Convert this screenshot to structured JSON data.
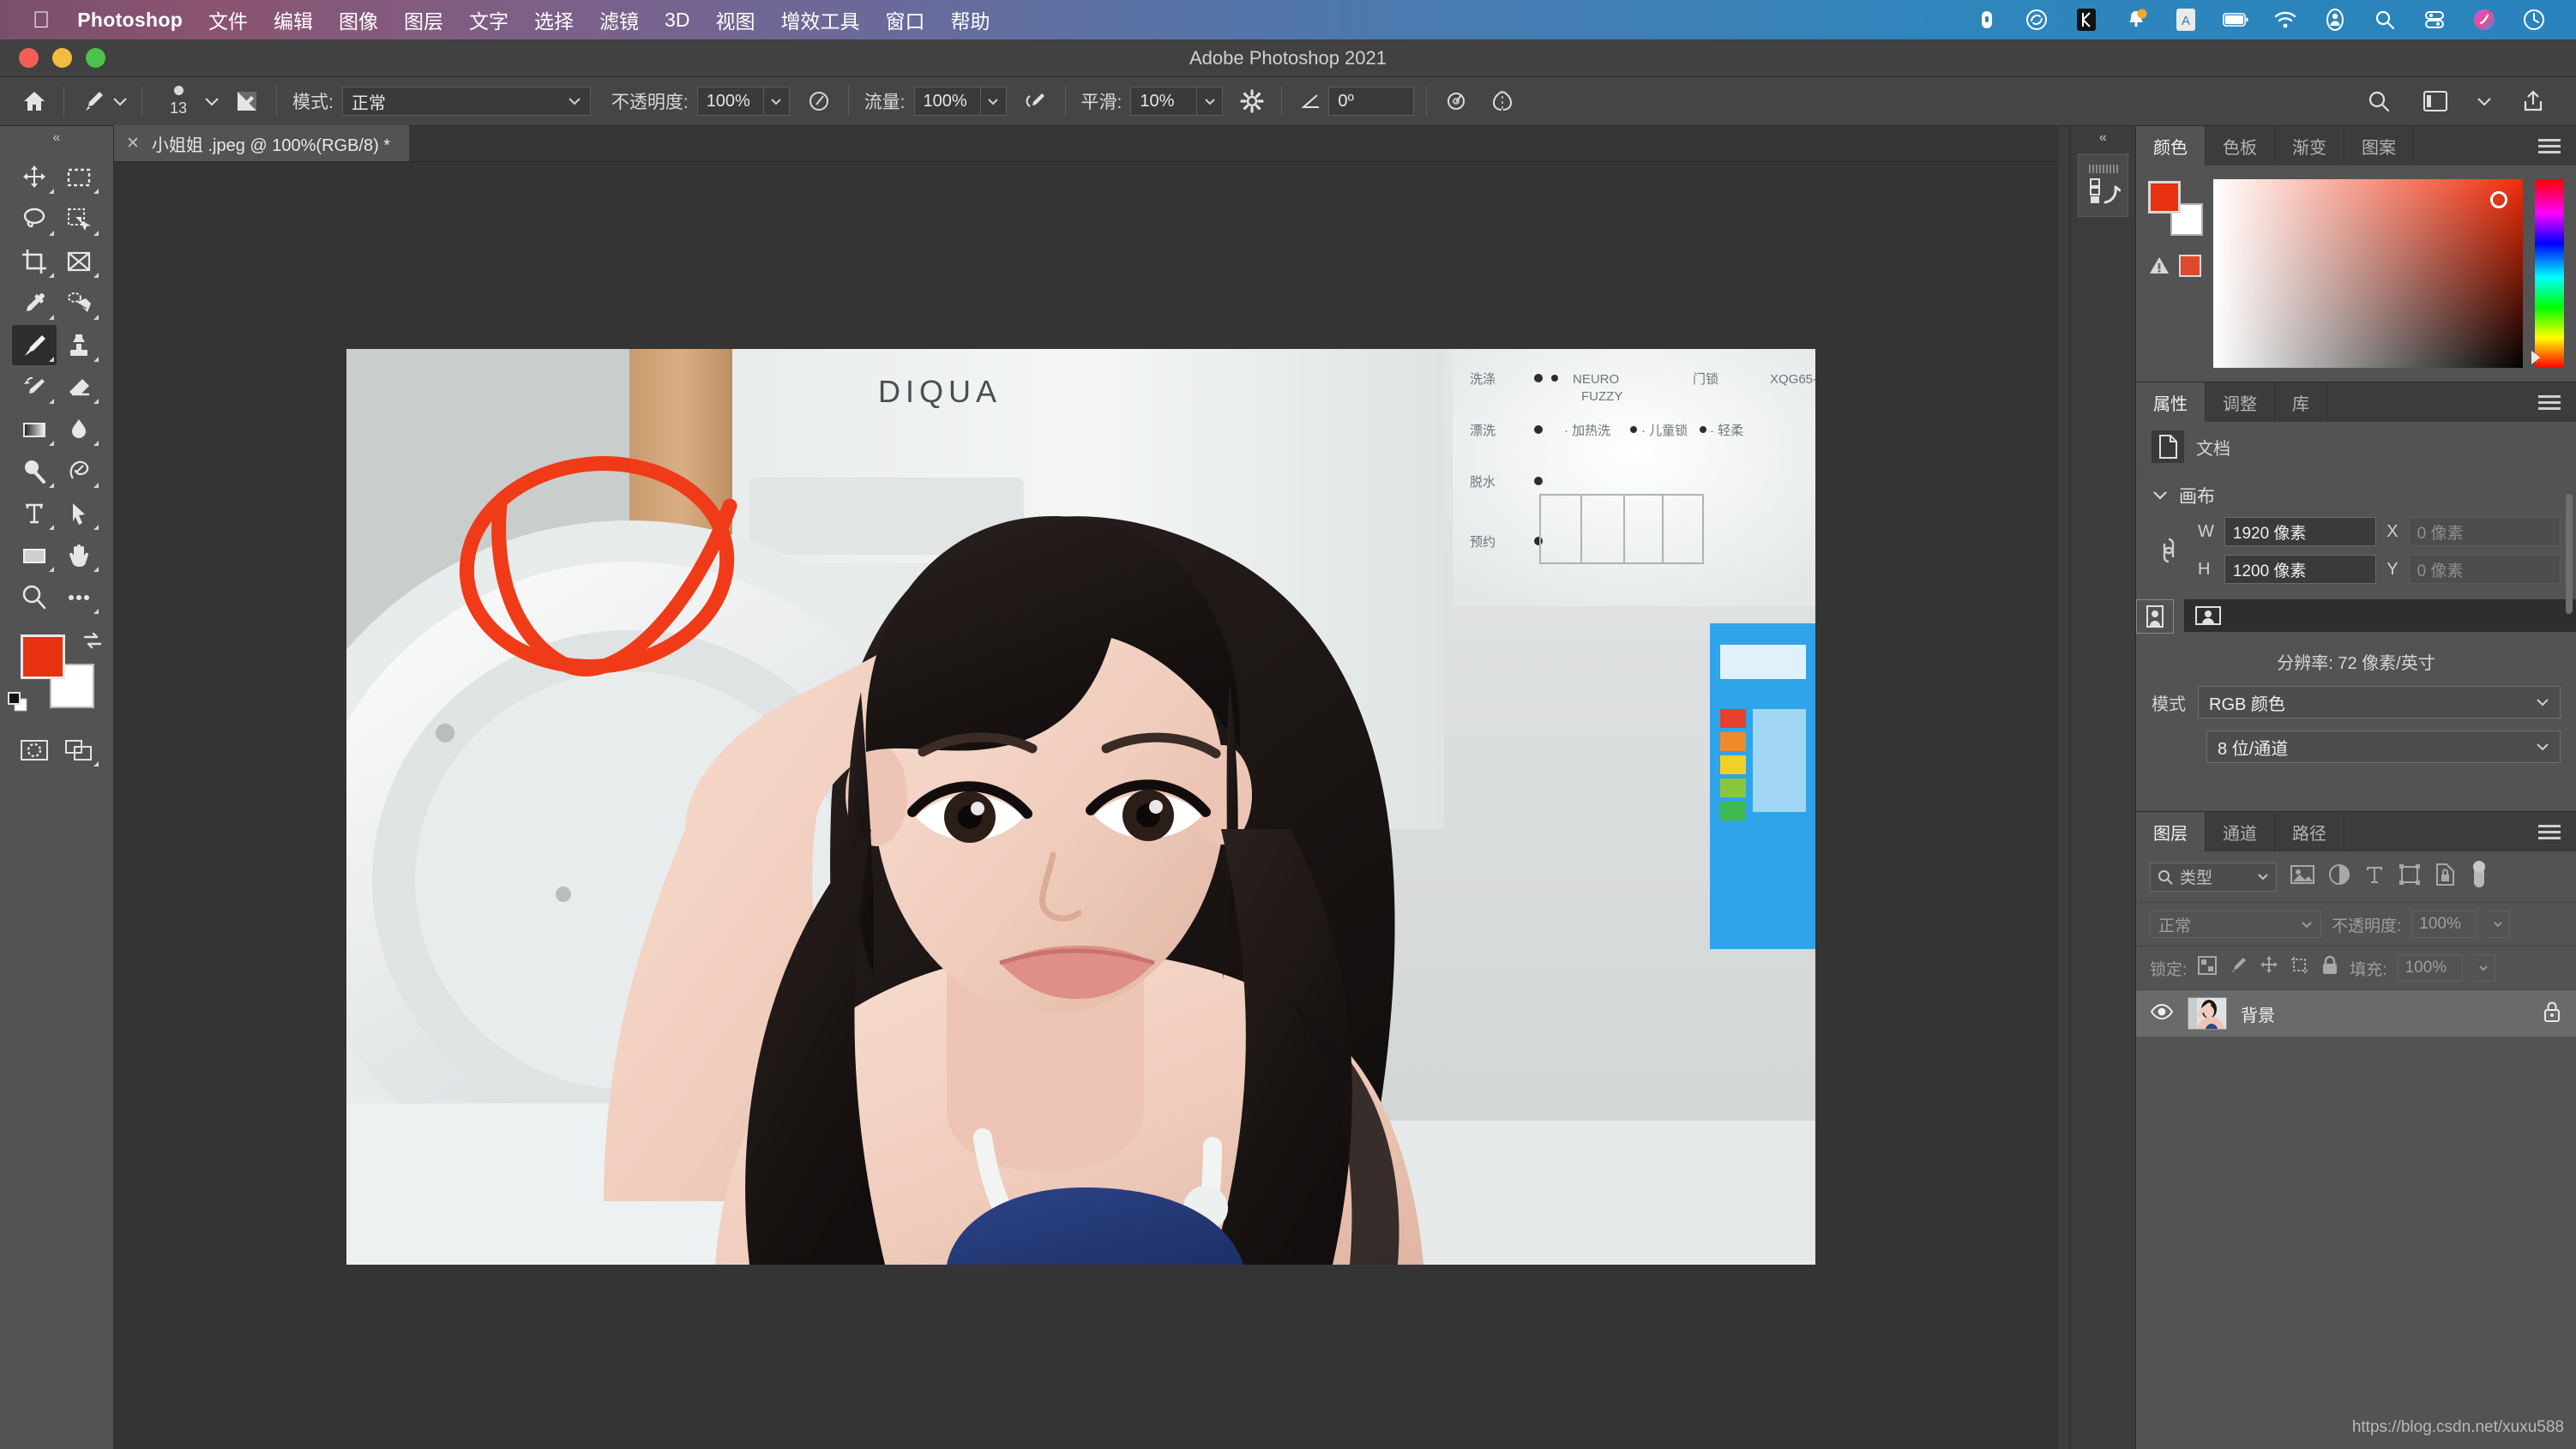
{
  "macmenu": {
    "app_name": "Photoshop",
    "items": [
      "文件",
      "编辑",
      "图像",
      "图层",
      "文字",
      "选择",
      "滤镜",
      "3D",
      "视图",
      "增效工具",
      "窗口",
      "帮助"
    ],
    "status_icons": [
      "record-icon",
      "creative-cloud-icon",
      "app-k-icon",
      "bell-icon",
      "input-source-icon",
      "battery-icon",
      "wifi-icon",
      "user-icon",
      "spotlight-search-icon",
      "control-center-icon",
      "siri-icon",
      "time-machine-icon"
    ]
  },
  "titlebar": {
    "title": "Adobe Photoshop 2021",
    "traffic_lights": [
      "close-button",
      "minimize-button",
      "zoom-button"
    ]
  },
  "optionsbar": {
    "home_icon": "home-icon",
    "tool_icon": "brush-tool-icon",
    "brush_size": "13",
    "brush_preset_icon": "brush-preset-icon",
    "mode_label": "模式:",
    "mode_value": "正常",
    "opacity_label": "不透明度:",
    "opacity_value": "100%",
    "pressure_opacity_icon": "pressure-opacity-icon",
    "flow_label": "流量:",
    "flow_value": "100%",
    "airbrush_icon": "airbrush-icon",
    "smoothing_label": "平滑:",
    "smoothing_value": "10%",
    "smoothing_gear_icon": "gear-icon",
    "angle_icon": "angle-icon",
    "angle_value": "0º",
    "pressure_size_icon": "pressure-size-icon",
    "symmetry_icon": "symmetry-icon",
    "search_icon": "search-icon",
    "workspace_icon": "workspace-icon",
    "workspace_caret_icon": "chevron-down-icon",
    "share_icon": "share-icon"
  },
  "tabbar": {
    "document_tab": "小姐姐 .jpeg @ 100%(RGB/8) *",
    "close_icon": "close-icon"
  },
  "toolbar": {
    "collapse_icon": "collapse-left-icon",
    "tools": [
      {
        "name": "move-tool",
        "icon": "move-icon"
      },
      {
        "name": "marquee-tool",
        "icon": "rectangular-marquee-icon"
      },
      {
        "name": "lasso-tool",
        "icon": "lasso-icon"
      },
      {
        "name": "quick-selection-tool",
        "icon": "quick-selection-icon"
      },
      {
        "name": "crop-tool",
        "icon": "crop-icon"
      },
      {
        "name": "frame-tool",
        "icon": "frame-icon"
      },
      {
        "name": "eyedropper-tool",
        "icon": "eyedropper-icon"
      },
      {
        "name": "spot-healing-tool",
        "icon": "healing-brush-icon"
      },
      {
        "name": "brush-tool",
        "icon": "brush-icon"
      },
      {
        "name": "clone-stamp-tool",
        "icon": "clone-stamp-icon"
      },
      {
        "name": "history-brush-tool",
        "icon": "history-brush-icon"
      },
      {
        "name": "eraser-tool",
        "icon": "eraser-icon"
      },
      {
        "name": "gradient-tool",
        "icon": "gradient-icon"
      },
      {
        "name": "blur-tool",
        "icon": "blur-drop-icon"
      },
      {
        "name": "dodge-tool",
        "icon": "dodge-icon"
      },
      {
        "name": "pen-tool",
        "icon": "pen-icon"
      },
      {
        "name": "type-tool",
        "icon": "type-t-icon"
      },
      {
        "name": "path-selection-tool",
        "icon": "path-arrow-icon"
      },
      {
        "name": "rectangle-tool",
        "icon": "rectangle-icon"
      },
      {
        "name": "hand-tool",
        "icon": "hand-icon"
      },
      {
        "name": "zoom-tool",
        "icon": "magnifier-icon"
      },
      {
        "name": "edit-toolbar",
        "icon": "ellipsis-icon"
      }
    ],
    "active_tool": "brush-tool",
    "foreground_color": "#e8320f",
    "background_color": "#ffffff",
    "swap_icon": "swap-colors-icon",
    "default_icon": "default-colors-icon",
    "quickmask_icon": "quick-mask-icon",
    "screenmode_icon": "screen-mode-icon"
  },
  "canvas": {
    "photo_alt": "laundry-room-portrait-photo",
    "appliance_brand_text": "DIQUA",
    "annotation": "red-checkmark-circle-annotation",
    "annotation_color": "#f03b18"
  },
  "dockstrip": {
    "collapse_icon": "collapse-right-icon",
    "history_icon": "history-panel-icon"
  },
  "color_panel": {
    "tabs": [
      "颜色",
      "色板",
      "渐变",
      "图案"
    ],
    "active_tab": "颜色",
    "menu_icon": "panel-menu-icon",
    "foreground": "#e8320f",
    "background": "#ffffff",
    "out_of_gamut_icon": "gamut-warning-icon",
    "out_of_gamut_swatch": "#e0492a"
  },
  "properties_panel": {
    "tabs": [
      "属性",
      "调整",
      "库"
    ],
    "active_tab": "属性",
    "menu_icon": "panel-menu-icon",
    "doc_icon": "document-icon",
    "doc_label": "文档",
    "section_label": "画布",
    "section_caret_icon": "chevron-down-icon",
    "link_icon": "link-chain-icon",
    "w_label": "W",
    "w_value": "1920 像素",
    "x_label": "X",
    "x_value": "0 像素",
    "h_label": "H",
    "h_value": "1200 像素",
    "y_label": "Y",
    "y_value": "0 像素",
    "portrait_icon": "portrait-orientation-icon",
    "landscape_icon": "landscape-orientation-icon",
    "orientation_selected": "landscape",
    "resolution_text": "分辨率: 72 像素/英寸",
    "mode_label": "模式",
    "mode_value": "RGB 颜色",
    "depth_value": "8 位/通道",
    "caret_icon": "chevron-down-icon"
  },
  "layers_panel": {
    "tabs": [
      "图层",
      "通道",
      "路径"
    ],
    "active_tab": "图层",
    "menu_icon": "panel-menu-icon",
    "filter_search_icon": "search-icon",
    "filter_label": "类型",
    "filter_caret_icon": "chevron-down-icon",
    "filter_icons": [
      "pixel-layer-filter-icon",
      "adjustment-layer-filter-icon",
      "type-layer-filter-icon",
      "shape-layer-filter-icon",
      "smart-object-filter-icon"
    ],
    "filter_toggle_icon": "filter-toggle-icon",
    "blend_mode": "正常",
    "opacity_label": "不透明度:",
    "opacity_value": "100%",
    "lock_label": "锁定:",
    "lock_icons": [
      "lock-transparency-icon",
      "lock-image-icon",
      "lock-position-icon",
      "lock-artboard-icon",
      "lock-all-icon"
    ],
    "fill_label": "填充:",
    "fill_value": "100%",
    "layers": [
      {
        "name": "背景",
        "visible": true,
        "locked": true,
        "eye_icon": "eye-icon",
        "lock_icon": "lock-icon",
        "thumbnail": "background-layer-thumbnail"
      }
    ]
  },
  "watermark": {
    "text": "https://blog.csdn.net/xuxu588"
  }
}
